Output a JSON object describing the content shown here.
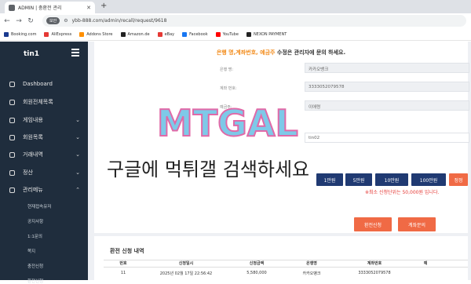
{
  "browser": {
    "tab_title": "ADMIN | 충환전 관리",
    "url_badge": "보안",
    "url": "ybb-888.com/admin/recall/request/9618",
    "bookmarks": [
      "Booking.com",
      "AliExpress",
      "Addons Store",
      "Amazon.de",
      "eBay",
      "Facebook",
      "YouTube",
      "NEXON PAYMENT"
    ],
    "bookmark_colors": [
      "#1a3a8f",
      "#e53935",
      "#ff8f00",
      "#222222",
      "#e53935",
      "#1877f2",
      "#ff0000",
      "#222222"
    ]
  },
  "sidebar": {
    "brand": "tin1",
    "items": [
      "Dashboard",
      "회원전체목록",
      "게임내용",
      "회원목록",
      "거래내역",
      "정산",
      "관리메뉴"
    ],
    "subitems": [
      "현재접속유저",
      "공지사항",
      "1:1문의",
      "쪽지",
      "충전신청",
      "환전신청"
    ]
  },
  "form": {
    "notice_prefix": "은행 명,계좌번호, 예금주",
    "notice_suffix": "수정은 관리자에 문의 하세요.",
    "labels": [
      "은행 명:",
      "계좌 번호:",
      "예금주:"
    ],
    "bank": "카카오뱅크",
    "account": "3333052079578",
    "holder": "이애령",
    "amount": "tin02",
    "amount_buttons": [
      "1만원",
      "5만원",
      "10만원",
      "100만원"
    ],
    "reset": "정정",
    "min_notice": "※최소 신청단위는 50,000원 입니다.",
    "submit": "환전신청",
    "cancel": "계좌문의"
  },
  "history": {
    "title": "환전 신청 내역",
    "headers": [
      "번호",
      "신청일시",
      "신청금액",
      "은행명",
      "계좌번호",
      "예"
    ],
    "rows": [
      [
        "11",
        "2025년 02월 17일 22:56:42",
        "5,580,000",
        "카카오뱅크",
        "3333052079578",
        ""
      ]
    ]
  },
  "overlay": {
    "logo": "MTGAL",
    "text": "구글에 먹튀갤 검색하세요"
  }
}
